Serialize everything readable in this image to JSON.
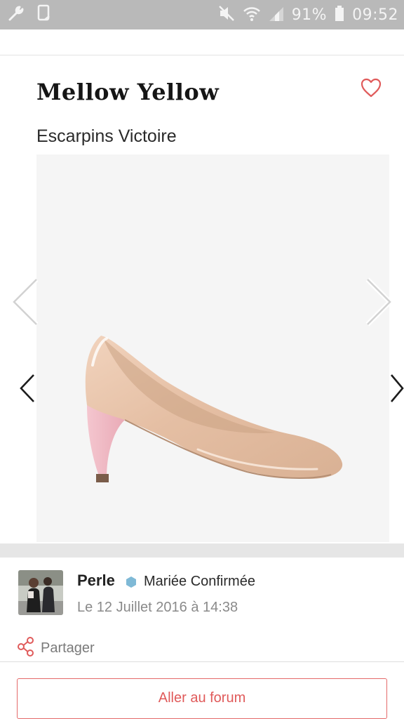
{
  "status_bar": {
    "icons": [
      "wrench-icon",
      "phone-icon",
      "mute-icon",
      "wifi-icon",
      "signal-icon",
      "battery-icon"
    ],
    "battery": "91%",
    "time": "09:52"
  },
  "card": {
    "title": "Mellow Yellow",
    "subtitle": "Escarpins Victoire",
    "favorite_icon": "heart-icon",
    "image_alt": "nude patent pump with pink heel"
  },
  "post": {
    "author": "Perle",
    "badge_icon": "hexagon-badge-icon",
    "role": "Mariée Confirmée",
    "date": "Le 12 Juillet 2016 à 14:38"
  },
  "share": {
    "label": "Partager",
    "icon": "share-icon"
  },
  "forum_button": {
    "label": "Aller au forum"
  },
  "colors": {
    "status_bar": "#b9b9b9",
    "accent": "#e05a5a",
    "badge": "#7fb9d6",
    "photo_bg": "#f5f5f5"
  }
}
